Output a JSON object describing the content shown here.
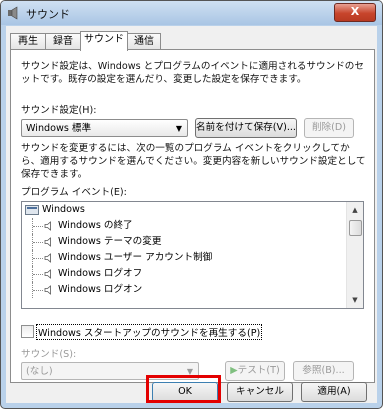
{
  "window": {
    "title": "サウンド",
    "close_glyph": "X"
  },
  "tabs": [
    {
      "label": "再生",
      "active": false
    },
    {
      "label": "録音",
      "active": false
    },
    {
      "label": "サウンド",
      "active": true
    },
    {
      "label": "通信",
      "active": false
    }
  ],
  "panel": {
    "description": "サウンド設定は、Windows とプログラムのイベントに適用されるサウンドのセットです。既存の設定を選んだり、変更した設定を保存できます。",
    "scheme_label": "サウンド設定(H):",
    "scheme_value": "Windows 標準",
    "save_as_label": "名前を付けて保存(V)...",
    "delete_label": "削除(D)",
    "change_description": "サウンドを変更するには、次の一覧のプログラム イベントをクリックしてから、適用するサウンドを選んでください。変更内容を新しいサウンド設定として保存できます。",
    "events_label": "プログラム イベント(E):",
    "events": [
      "Windows",
      "Windows の終了",
      "Windows テーマの変更",
      "Windows ユーザー アカウント制御",
      "Windows ログオフ",
      "Windows ログオン"
    ],
    "startup_checkbox_label": "Windows スタートアップのサウンドを再生する(P)",
    "startup_checked": false,
    "sounds_label": "サウンド(S):",
    "sound_value": "(なし)",
    "test_label": "テスト(T)",
    "browse_label": "参照(B)..."
  },
  "footer": {
    "ok_label": "OK",
    "cancel_label": "キャンセル",
    "apply_label": "適用(A)"
  },
  "colors": {
    "highlight": "#e30000",
    "title_bar": "#b9d1ea",
    "close_button": "#c7452c"
  }
}
